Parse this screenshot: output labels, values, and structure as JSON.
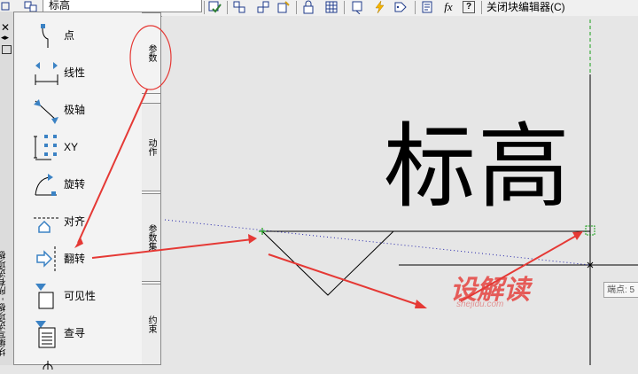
{
  "toolbar": {
    "name_box_value": "标高",
    "close_editor_label": "关闭块编辑器(C)",
    "fx_label": "fx",
    "help_label": "?"
  },
  "palette": {
    "close_glyph": "✕",
    "vertical_title": "块编写选项板 - 所有选项板",
    "items": [
      {
        "label": "点",
        "icon": "point-param-icon"
      },
      {
        "label": "线性",
        "icon": "linear-param-icon"
      },
      {
        "label": "极轴",
        "icon": "polar-param-icon"
      },
      {
        "label": "XY",
        "icon": "xy-param-icon"
      },
      {
        "label": "旋转",
        "icon": "rotation-param-icon"
      },
      {
        "label": "对齐",
        "icon": "alignment-param-icon"
      },
      {
        "label": "翻转",
        "icon": "flip-param-icon"
      },
      {
        "label": "可见性",
        "icon": "visibility-param-icon"
      },
      {
        "label": "查寻",
        "icon": "lookup-param-icon"
      }
    ],
    "tabs": [
      "参数",
      "动作",
      "参数集",
      "约束"
    ]
  },
  "canvas": {
    "block_text": "标高",
    "tooltip_text": "端点: 5",
    "watermark": "设解读",
    "watermark_sub": "shejidu.com"
  },
  "colors": {
    "annotation_red": "#e53935",
    "grip_green": "#00aa00",
    "toolbar_icon_blue": "#1e3a8a"
  }
}
